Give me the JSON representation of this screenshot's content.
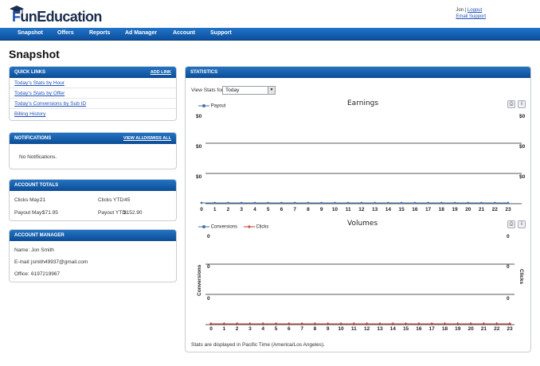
{
  "header": {
    "logo_text_f": "F",
    "logo_text_rest": "unEducation",
    "user_name": "Jon",
    "separator": "|",
    "logout_label": "Logout",
    "support_label": "Email Support"
  },
  "nav": {
    "items": [
      "Snapshot",
      "Offers",
      "Reports",
      "Ad Manager",
      "Account",
      "Support"
    ]
  },
  "page_title": "Snapshot",
  "quick_links": {
    "title": "QUICK LINKS",
    "action": "ADD LINK",
    "items": [
      "Today's Stats by Hour",
      "Today's Stats by Offer",
      "Today's Conversions by Sub ID",
      "Billing History"
    ]
  },
  "notifications": {
    "title": "NOTIFICATIONS",
    "view_all": "VIEW ALL",
    "dismiss_all": "DISMISS ALL",
    "empty_text": "No Notifications."
  },
  "account_totals": {
    "title": "ACCOUNT TOTALS",
    "clicks_may_label": "Clicks May:",
    "clicks_may_value": "21",
    "clicks_ytd_label": "Clicks YTD:",
    "clicks_ytd_value": "45",
    "payout_may_label": "Payout May:",
    "payout_may_value": "$71.95",
    "payout_ytd_label": "Payout YTD:",
    "payout_ytd_value": "$152.90"
  },
  "account_manager": {
    "title": "ACCOUNT MANAGER",
    "name_label": "Name:",
    "name_value": "Jon Smith",
    "email_label": "E-mail:",
    "email_value": "jsmith49937@gmail.com",
    "office_label": "Office:",
    "office_value": "6197219967"
  },
  "statistics": {
    "title": "STATISTICS",
    "view_stats_label": "View Stats for",
    "period_selected": "Today",
    "footer_note": "Stats are displayed in Pacific Time (America/Los Angeles)."
  },
  "icons": {
    "print": "print-icon",
    "export": "export-icon",
    "dropdown": "chevron-down-icon"
  },
  "colors": {
    "nav_blue": "#0d4f9c",
    "payout_series": "#4572a7",
    "conversions_series": "#4572a7",
    "clicks_series": "#c0392b"
  },
  "chart_data": [
    {
      "type": "line",
      "title": "Earnings",
      "x": [
        0,
        1,
        2,
        3,
        4,
        5,
        6,
        7,
        8,
        9,
        10,
        11,
        12,
        13,
        14,
        15,
        16,
        17,
        18,
        19,
        20,
        21,
        22,
        23
      ],
      "series": [
        {
          "name": "Payout",
          "values": [
            0,
            0,
            0,
            0,
            0,
            0,
            0,
            0,
            0,
            0,
            0,
            0,
            0,
            0,
            0,
            0,
            0,
            0,
            0,
            0,
            0,
            0,
            0,
            0
          ]
        }
      ],
      "ytick_labels": [
        "$0",
        "$0",
        "$0"
      ],
      "legend": "top-left",
      "grid": true
    },
    {
      "type": "line",
      "title": "Volumes",
      "x": [
        0,
        1,
        2,
        3,
        4,
        5,
        6,
        7,
        8,
        9,
        10,
        11,
        12,
        13,
        14,
        15,
        16,
        17,
        18,
        19,
        20,
        21,
        22,
        23
      ],
      "series": [
        {
          "name": "Conversions",
          "values": [
            0,
            0,
            0,
            0,
            0,
            0,
            0,
            0,
            0,
            0,
            0,
            0,
            0,
            0,
            0,
            0,
            0,
            0,
            0,
            0,
            0,
            0,
            0,
            0
          ]
        },
        {
          "name": "Clicks",
          "values": [
            0,
            0,
            0,
            0,
            0,
            0,
            0,
            0,
            0,
            0,
            0,
            0,
            0,
            0,
            0,
            0,
            0,
            0,
            0,
            0,
            0,
            0,
            0,
            0
          ]
        }
      ],
      "ylabel_left": "Conversions",
      "ylabel_right": "Clicks",
      "ytick_labels": [
        "0",
        "0",
        "0"
      ],
      "legend": "top-left",
      "grid": true
    }
  ]
}
